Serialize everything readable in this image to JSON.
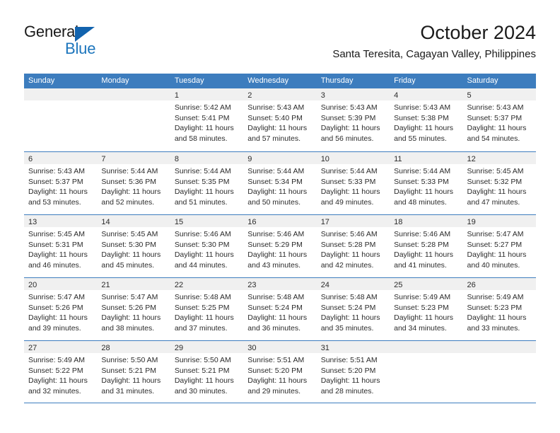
{
  "brand": {
    "name_part1": "General",
    "name_part2": "Blue",
    "triangle_color": "#1263ae",
    "blue_color": "#1c75bc"
  },
  "header": {
    "title": "October 2024",
    "subtitle": "Santa Teresita, Cagayan Valley, Philippines"
  },
  "colors": {
    "header_blue": "#3d7dbe",
    "day_band_gray": "#f0f0f0",
    "text": "#2b2b2b"
  },
  "weekdays": [
    "Sunday",
    "Monday",
    "Tuesday",
    "Wednesday",
    "Thursday",
    "Friday",
    "Saturday"
  ],
  "weeks": [
    [
      {
        "day": "",
        "empty": true,
        "lines": []
      },
      {
        "day": "",
        "empty": true,
        "lines": []
      },
      {
        "day": "1",
        "lines": [
          "Sunrise: 5:42 AM",
          "Sunset: 5:41 PM",
          "Daylight: 11 hours",
          "and 58 minutes."
        ]
      },
      {
        "day": "2",
        "lines": [
          "Sunrise: 5:43 AM",
          "Sunset: 5:40 PM",
          "Daylight: 11 hours",
          "and 57 minutes."
        ]
      },
      {
        "day": "3",
        "lines": [
          "Sunrise: 5:43 AM",
          "Sunset: 5:39 PM",
          "Daylight: 11 hours",
          "and 56 minutes."
        ]
      },
      {
        "day": "4",
        "lines": [
          "Sunrise: 5:43 AM",
          "Sunset: 5:38 PM",
          "Daylight: 11 hours",
          "and 55 minutes."
        ]
      },
      {
        "day": "5",
        "lines": [
          "Sunrise: 5:43 AM",
          "Sunset: 5:37 PM",
          "Daylight: 11 hours",
          "and 54 minutes."
        ]
      }
    ],
    [
      {
        "day": "6",
        "lines": [
          "Sunrise: 5:43 AM",
          "Sunset: 5:37 PM",
          "Daylight: 11 hours",
          "and 53 minutes."
        ]
      },
      {
        "day": "7",
        "lines": [
          "Sunrise: 5:44 AM",
          "Sunset: 5:36 PM",
          "Daylight: 11 hours",
          "and 52 minutes."
        ]
      },
      {
        "day": "8",
        "lines": [
          "Sunrise: 5:44 AM",
          "Sunset: 5:35 PM",
          "Daylight: 11 hours",
          "and 51 minutes."
        ]
      },
      {
        "day": "9",
        "lines": [
          "Sunrise: 5:44 AM",
          "Sunset: 5:34 PM",
          "Daylight: 11 hours",
          "and 50 minutes."
        ]
      },
      {
        "day": "10",
        "lines": [
          "Sunrise: 5:44 AM",
          "Sunset: 5:33 PM",
          "Daylight: 11 hours",
          "and 49 minutes."
        ]
      },
      {
        "day": "11",
        "lines": [
          "Sunrise: 5:44 AM",
          "Sunset: 5:33 PM",
          "Daylight: 11 hours",
          "and 48 minutes."
        ]
      },
      {
        "day": "12",
        "lines": [
          "Sunrise: 5:45 AM",
          "Sunset: 5:32 PM",
          "Daylight: 11 hours",
          "and 47 minutes."
        ]
      }
    ],
    [
      {
        "day": "13",
        "lines": [
          "Sunrise: 5:45 AM",
          "Sunset: 5:31 PM",
          "Daylight: 11 hours",
          "and 46 minutes."
        ]
      },
      {
        "day": "14",
        "lines": [
          "Sunrise: 5:45 AM",
          "Sunset: 5:30 PM",
          "Daylight: 11 hours",
          "and 45 minutes."
        ]
      },
      {
        "day": "15",
        "lines": [
          "Sunrise: 5:46 AM",
          "Sunset: 5:30 PM",
          "Daylight: 11 hours",
          "and 44 minutes."
        ]
      },
      {
        "day": "16",
        "lines": [
          "Sunrise: 5:46 AM",
          "Sunset: 5:29 PM",
          "Daylight: 11 hours",
          "and 43 minutes."
        ]
      },
      {
        "day": "17",
        "lines": [
          "Sunrise: 5:46 AM",
          "Sunset: 5:28 PM",
          "Daylight: 11 hours",
          "and 42 minutes."
        ]
      },
      {
        "day": "18",
        "lines": [
          "Sunrise: 5:46 AM",
          "Sunset: 5:28 PM",
          "Daylight: 11 hours",
          "and 41 minutes."
        ]
      },
      {
        "day": "19",
        "lines": [
          "Sunrise: 5:47 AM",
          "Sunset: 5:27 PM",
          "Daylight: 11 hours",
          "and 40 minutes."
        ]
      }
    ],
    [
      {
        "day": "20",
        "lines": [
          "Sunrise: 5:47 AM",
          "Sunset: 5:26 PM",
          "Daylight: 11 hours",
          "and 39 minutes."
        ]
      },
      {
        "day": "21",
        "lines": [
          "Sunrise: 5:47 AM",
          "Sunset: 5:26 PM",
          "Daylight: 11 hours",
          "and 38 minutes."
        ]
      },
      {
        "day": "22",
        "lines": [
          "Sunrise: 5:48 AM",
          "Sunset: 5:25 PM",
          "Daylight: 11 hours",
          "and 37 minutes."
        ]
      },
      {
        "day": "23",
        "lines": [
          "Sunrise: 5:48 AM",
          "Sunset: 5:24 PM",
          "Daylight: 11 hours",
          "and 36 minutes."
        ]
      },
      {
        "day": "24",
        "lines": [
          "Sunrise: 5:48 AM",
          "Sunset: 5:24 PM",
          "Daylight: 11 hours",
          "and 35 minutes."
        ]
      },
      {
        "day": "25",
        "lines": [
          "Sunrise: 5:49 AM",
          "Sunset: 5:23 PM",
          "Daylight: 11 hours",
          "and 34 minutes."
        ]
      },
      {
        "day": "26",
        "lines": [
          "Sunrise: 5:49 AM",
          "Sunset: 5:23 PM",
          "Daylight: 11 hours",
          "and 33 minutes."
        ]
      }
    ],
    [
      {
        "day": "27",
        "lines": [
          "Sunrise: 5:49 AM",
          "Sunset: 5:22 PM",
          "Daylight: 11 hours",
          "and 32 minutes."
        ]
      },
      {
        "day": "28",
        "lines": [
          "Sunrise: 5:50 AM",
          "Sunset: 5:21 PM",
          "Daylight: 11 hours",
          "and 31 minutes."
        ]
      },
      {
        "day": "29",
        "lines": [
          "Sunrise: 5:50 AM",
          "Sunset: 5:21 PM",
          "Daylight: 11 hours",
          "and 30 minutes."
        ]
      },
      {
        "day": "30",
        "lines": [
          "Sunrise: 5:51 AM",
          "Sunset: 5:20 PM",
          "Daylight: 11 hours",
          "and 29 minutes."
        ]
      },
      {
        "day": "31",
        "lines": [
          "Sunrise: 5:51 AM",
          "Sunset: 5:20 PM",
          "Daylight: 11 hours",
          "and 28 minutes."
        ]
      },
      {
        "day": "",
        "empty": true,
        "lines": []
      },
      {
        "day": "",
        "empty": true,
        "lines": []
      }
    ]
  ]
}
